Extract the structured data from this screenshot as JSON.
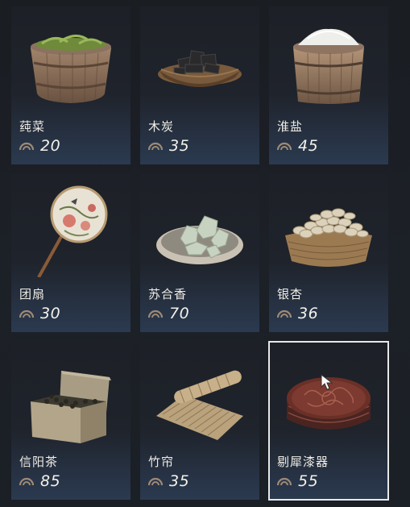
{
  "items": [
    {
      "name": "莼菜",
      "price": "20",
      "icon": "water-shield-basket-icon"
    },
    {
      "name": "木炭",
      "price": "35",
      "icon": "charcoal-basket-icon"
    },
    {
      "name": "淮盐",
      "price": "45",
      "icon": "salt-bucket-icon"
    },
    {
      "name": "团扇",
      "price": "30",
      "icon": "round-fan-icon"
    },
    {
      "name": "苏合香",
      "price": "70",
      "icon": "storax-resin-dish-icon"
    },
    {
      "name": "银杏",
      "price": "36",
      "icon": "ginkgo-basket-icon"
    },
    {
      "name": "信阳茶",
      "price": "85",
      "icon": "tea-box-icon"
    },
    {
      "name": "竹帘",
      "price": "35",
      "icon": "bamboo-blind-icon"
    },
    {
      "name": "剔犀漆器",
      "price": "55",
      "icon": "lacquer-box-icon"
    }
  ],
  "selected_index": 8,
  "currency_icon": "coin-icon",
  "colors": {
    "card_bottom": "#2b3a50",
    "selection_border": "#e8e8e8",
    "text": "#f0ede6"
  }
}
